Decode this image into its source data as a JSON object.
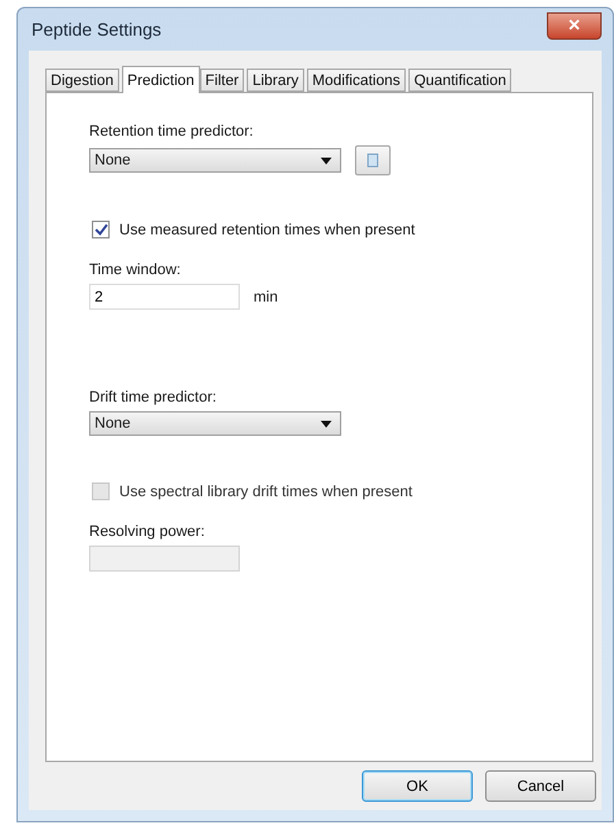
{
  "window": {
    "title": "Peptide Settings",
    "close": "×"
  },
  "tabs": [
    {
      "label": "Digestion",
      "selected": false
    },
    {
      "label": "Prediction",
      "selected": true
    },
    {
      "label": "Filter",
      "selected": false
    },
    {
      "label": "Library",
      "selected": false
    },
    {
      "label": "Modifications",
      "selected": false
    },
    {
      "label": "Quantification",
      "selected": false
    }
  ],
  "retention": {
    "label": "Retention time predictor:",
    "value": "None"
  },
  "use_measured": {
    "label": "Use measured retention times when present",
    "checked": true,
    "disabled": false
  },
  "time_window": {
    "label": "Time window:",
    "value": "2",
    "unit": "min"
  },
  "drift": {
    "label": "Drift time predictor:",
    "value": "None"
  },
  "use_spectral": {
    "label": "Use spectral library drift times when present",
    "checked": false,
    "disabled": true
  },
  "resolving_power": {
    "label": "Resolving power:",
    "disabled": true
  },
  "buttons": [
    {
      "label": "OK",
      "default": true
    },
    {
      "label": "Cancel",
      "default": false
    }
  ]
}
